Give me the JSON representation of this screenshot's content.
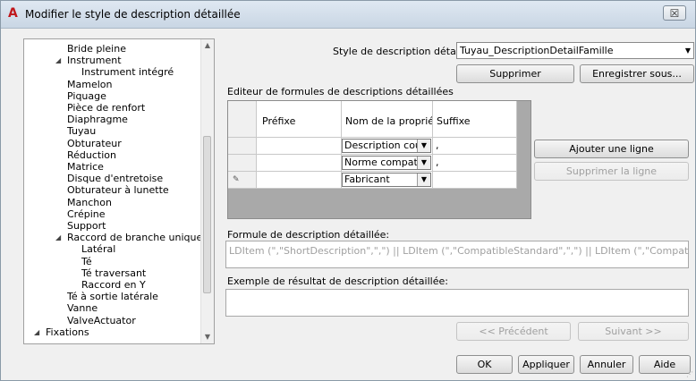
{
  "window": {
    "title": "Modifier le style de description détaillée",
    "close_glyph": "☒"
  },
  "tree": {
    "items": [
      {
        "label": "Bride pleine",
        "expander": ""
      },
      {
        "label": "Instrument",
        "expander": "◢"
      },
      {
        "label": "Instrument intégré",
        "expander": ""
      },
      {
        "label": "Mamelon",
        "expander": ""
      },
      {
        "label": "Piquage",
        "expander": ""
      },
      {
        "label": "Pièce de renfort",
        "expander": ""
      },
      {
        "label": "Diaphragme",
        "expander": ""
      },
      {
        "label": "Tuyau",
        "expander": ""
      },
      {
        "label": "Obturateur",
        "expander": ""
      },
      {
        "label": "Réduction",
        "expander": ""
      },
      {
        "label": "Matrice",
        "expander": ""
      },
      {
        "label": "Disque d'entretoise",
        "expander": ""
      },
      {
        "label": "Obturateur à lunette",
        "expander": ""
      },
      {
        "label": "Manchon",
        "expander": ""
      },
      {
        "label": "Crépine",
        "expander": ""
      },
      {
        "label": "Support",
        "expander": ""
      },
      {
        "label": "Raccord de branche unique",
        "expander": "◢"
      },
      {
        "label": "Latéral",
        "expander": ""
      },
      {
        "label": "Té",
        "expander": ""
      },
      {
        "label": "Té traversant",
        "expander": ""
      },
      {
        "label": "Raccord en Y",
        "expander": ""
      },
      {
        "label": "Té à sortie latérale",
        "expander": ""
      },
      {
        "label": "Vanne",
        "expander": ""
      },
      {
        "label": "ValveActuator",
        "expander": ""
      },
      {
        "label": "Fixations",
        "expander": "◢"
      }
    ],
    "selected": "Tuyau"
  },
  "style": {
    "label": "Style de description détaillée:",
    "value": "Tuyau_DescriptionDetailFamille",
    "delete_label": "Supprimer",
    "save_as_label": "Enregistrer sous..."
  },
  "editor": {
    "label": "Editeur de formules de descriptions détaillées",
    "headers": [
      "Préfixe",
      "Nom de la propriété",
      "Suffixe"
    ],
    "rows": [
      {
        "marker": "",
        "prefix": "",
        "property": "Description cou...",
        "suffix": ","
      },
      {
        "marker": "",
        "prefix": "",
        "property": "Norme compati...",
        "suffix": ","
      },
      {
        "marker": "✎",
        "prefix": "",
        "property": "Fabricant",
        "suffix": ""
      }
    ],
    "add_row_label": "Ajouter une ligne",
    "delete_row_label": "Supprimer la ligne"
  },
  "formula": {
    "label": "Formule de description détaillée:",
    "value": "LDItem (\",\"ShortDescription\",\",\") || LDItem (\",\"CompatibleStandard\",\",\") || LDItem (\",\"CompatibleStandard\",\"\")"
  },
  "example": {
    "label": "Exemple de résultat de description détaillée:",
    "value": ""
  },
  "nav": {
    "previous_label": "<< Précédent",
    "next_label": "Suivant >>"
  },
  "footer": {
    "ok_label": "OK",
    "apply_label": "Appliquer",
    "cancel_label": "Annuler",
    "help_label": "Aide"
  }
}
